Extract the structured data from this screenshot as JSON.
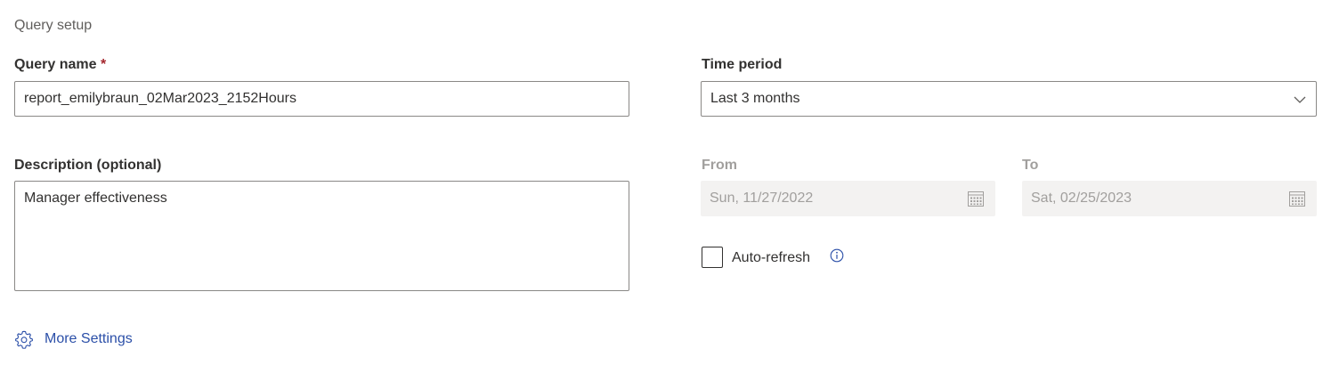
{
  "section_title": "Query setup",
  "query_name": {
    "label": "Query name",
    "required_marker": "*",
    "value": "report_emilybraun_02Mar2023_2152Hours"
  },
  "description": {
    "label": "Description (optional)",
    "value": "Manager effectiveness"
  },
  "time_period": {
    "label": "Time period",
    "selected": "Last 3 months",
    "icon": "chevron-down-icon"
  },
  "from": {
    "label": "From",
    "value": "Sun, 11/27/2022",
    "icon": "calendar-icon"
  },
  "to": {
    "label": "To",
    "value": "Sat, 02/25/2023",
    "icon": "calendar-icon"
  },
  "auto_refresh": {
    "label": "Auto-refresh",
    "checked": false,
    "icon": "info-icon"
  },
  "more_settings": {
    "label": "More Settings",
    "icon": "gear-icon"
  },
  "colors": {
    "link": "#2b4fa8",
    "required": "#a4262c",
    "disabled_bg": "#f3f2f1",
    "disabled_text": "#a19f9d"
  }
}
